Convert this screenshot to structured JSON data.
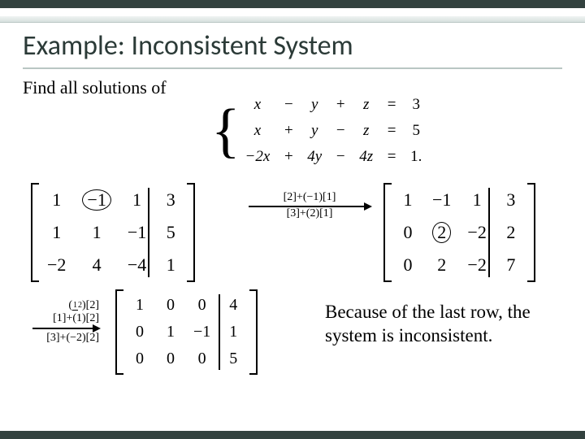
{
  "title": "Example: Inconsistent System",
  "prompt": "Find all solutions of",
  "system": {
    "rows": [
      [
        "x",
        "−",
        "y",
        "+",
        "z",
        "=",
        "3"
      ],
      [
        "x",
        "+",
        "y",
        "−",
        "z",
        "=",
        "5"
      ],
      [
        "−2x",
        "+",
        "4y",
        "−",
        "4z",
        "=",
        "1."
      ]
    ]
  },
  "matrix1": [
    [
      "1",
      "−1",
      "1",
      "3"
    ],
    [
      "1",
      "1",
      "−1",
      "5"
    ],
    [
      "−2",
      "4",
      "−4",
      "1"
    ]
  ],
  "matrix1_circle": {
    "row": 0,
    "col": 1
  },
  "rowops1": [
    "[2]+(−1)[1]",
    "[3]+(2)[1]"
  ],
  "matrix2": [
    [
      "1",
      "−1",
      "1",
      "3"
    ],
    [
      "0",
      "2",
      "−2",
      "2"
    ],
    [
      "0",
      "2",
      "−2",
      "7"
    ]
  ],
  "matrix2_circle": {
    "row": 1,
    "col": 1
  },
  "rowops2": [
    "(½)[2]",
    "[1]+(1)[2]",
    "[3]+(−2)[2]"
  ],
  "matrix3": [
    [
      "1",
      "0",
      "0",
      "4"
    ],
    [
      "0",
      "1",
      "−1",
      "1"
    ],
    [
      "0",
      "0",
      "0",
      "5"
    ]
  ],
  "conclusion": "Because of the last row, the system is inconsistent."
}
